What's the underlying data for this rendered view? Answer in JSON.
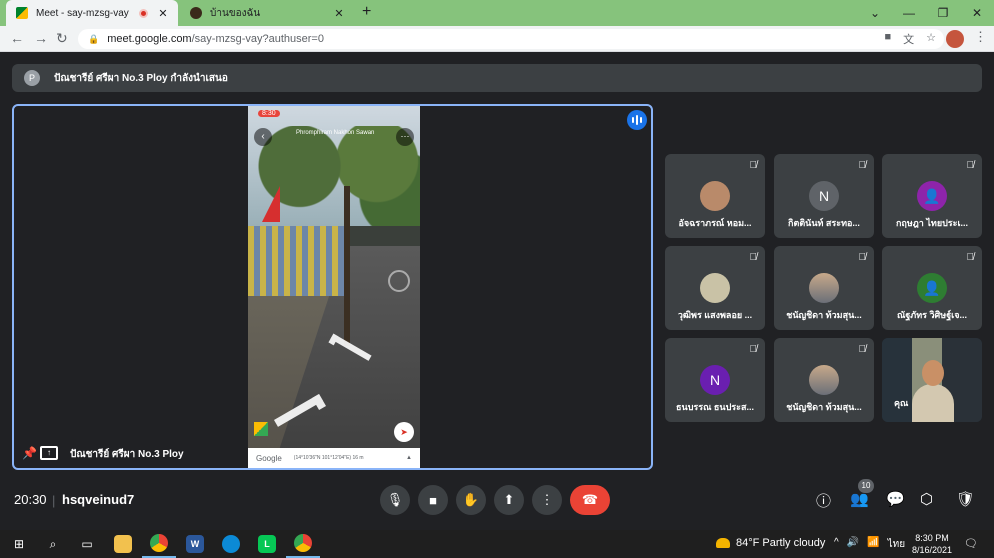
{
  "browser": {
    "tabs": [
      {
        "title": "Meet - say-mzsg-vay",
        "active": true,
        "recording": true
      },
      {
        "title": "บ้านของฉัน",
        "active": false
      }
    ],
    "new_tab": "+",
    "url_host": "meet.google.com",
    "url_path": "/say-mzsg-vay?authuser=0",
    "window_controls": {
      "minimize": "—",
      "maximize": "❐",
      "close": "✕"
    }
  },
  "banner": {
    "avatar_letter": "P",
    "text": "ปัณชารีย์ ศรีผา No.3 Ploy กำลังนำเสนอ"
  },
  "main": {
    "presenter_name": "ปัณชารีย์ ศรีผา No.3 Ploy",
    "phone": {
      "status_time": "8:30",
      "place_label": "Phromphiram Nakhon Sawan",
      "footer_logo": "Google",
      "footer_coords": "(14°10'36\"N 101°12'04\"E) 16 m"
    }
  },
  "participants": [
    {
      "name": "อัจฉราภรณ์ หอม...",
      "avatar": "photo",
      "avatar_color": "#b98a6a",
      "muted": true
    },
    {
      "name": "กิตตินันท์ สระทอ...",
      "avatar": "N",
      "avatar_color": "#5f6368",
      "muted": true
    },
    {
      "name": "กฤษฎา ไทยประเ...",
      "avatar": "person",
      "avatar_color": "#8e24aa",
      "muted": true
    },
    {
      "name": "วุฒิพร แสงพลอย ...",
      "avatar": "photo",
      "avatar_color": "#c9c2a6",
      "muted": true
    },
    {
      "name": "ชนัญชิดา ท้วมสุน...",
      "avatar": "photo",
      "avatar_color": "#d8a27a",
      "muted": true
    },
    {
      "name": "ณัฐภัทร วิศิษฐ์เจ...",
      "avatar": "person",
      "avatar_color": "#2e7d32",
      "muted": true
    },
    {
      "name": "ธนบรรณ ธนประส...",
      "avatar": "N",
      "avatar_color": "#6a1fb0",
      "muted": true
    },
    {
      "name": "ชนัญชิดา ท้วมสุน...",
      "avatar": "photo",
      "avatar_color": "#d8a27a",
      "muted": true
    },
    {
      "name": "คุณ",
      "avatar": "self-video",
      "muted": false
    }
  ],
  "bottombar": {
    "time": "20:30",
    "separator": "|",
    "meeting_code": "hsqveinud7",
    "participant_count": "10"
  },
  "taskbar": {
    "weather": "84°F  Partly cloudy",
    "lang": "ไทย",
    "time": "8:30 PM",
    "date": "8/16/2021"
  },
  "colors": {
    "tab_bar": "#86c37c",
    "meet_bg": "#202124",
    "tile_bg": "#3c4043",
    "end_call": "#ea4335",
    "active_border": "#8ab4f8"
  }
}
